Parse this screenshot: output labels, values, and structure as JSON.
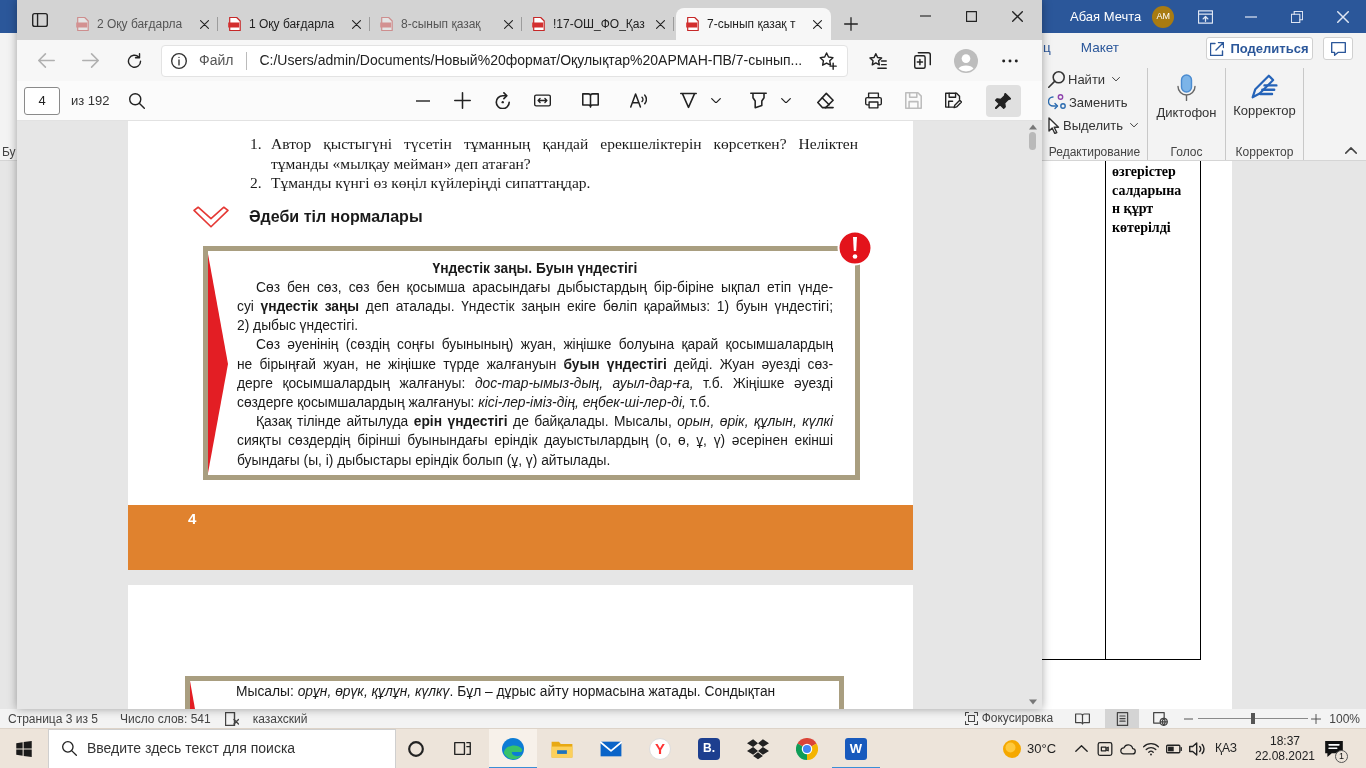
{
  "word_window": {
    "title_bar": {
      "user_name": "Абая Мечта",
      "avatar_initials": "АМ"
    },
    "ribbon_tabs": [
      {
        "label": "ц",
        "selected": false
      },
      {
        "label": "Макет",
        "selected": false
      }
    ],
    "share_button": "Поделиться",
    "ribbon": {
      "cut_group_label": "Бу",
      "groups": [
        {
          "kind": "small",
          "title": "Редактирование",
          "items": [
            {
              "kind": "find",
              "label": "Найти",
              "dropdown": true
            },
            {
              "kind": "replace",
              "label": "Заменить",
              "dropdown": false
            },
            {
              "kind": "select",
              "label": "Выделить",
              "dropdown": true
            }
          ]
        },
        {
          "kind": "large",
          "title": "Голос",
          "items": [
            {
              "kind": "dictate",
              "label": "Диктофон"
            }
          ]
        },
        {
          "kind": "large",
          "title": "Корректор",
          "items": [
            {
              "kind": "editor",
              "label": "Корректор"
            }
          ]
        }
      ]
    },
    "document": {
      "table_cell": "өзгерістер\nсалдарына\nн құрт\nкөтерілді"
    },
    "status_bar": {
      "page": "Страница 3 из 5",
      "word_count": "Число слов: 541",
      "language": "казахский",
      "focus": "Фокусировка",
      "views": [
        {
          "kind": "read",
          "selected": false
        },
        {
          "kind": "print",
          "selected": true
        },
        {
          "kind": "web",
          "selected": false
        }
      ],
      "zoom_slider": {
        "level": 0.5
      },
      "zoom": "100%"
    }
  },
  "browser_window": {
    "tabs": [
      {
        "title": "2 Оқу бағдарла",
        "sleeping": true,
        "selected": false
      },
      {
        "title": "1 Оқу бағдарла",
        "sleeping": false,
        "selected": false
      },
      {
        "title": "8-сынып қазақ",
        "sleeping": true,
        "selected": false
      },
      {
        "title": "!17-ОШ_ФО_Қаз",
        "sleeping": false,
        "selected": false
      },
      {
        "title": "7-сынып қазақ т",
        "sleeping": false,
        "selected": true
      }
    ],
    "nav_buttons": [
      {
        "kind": "back",
        "disabled": true
      },
      {
        "kind": "forward",
        "disabled": true
      },
      {
        "kind": "refresh",
        "disabled": false
      }
    ],
    "address_bar": {
      "scheme": "Файл",
      "url": "C:/Users/admin/Documents/Новый%20формат/Оқулықтар%20АРМАН-ПВ/7-сынып..."
    },
    "pdf_toolbar": {
      "page_number": "4",
      "page_count": "из 192",
      "tools": [
        {
          "kind": "zoom_out",
          "disabled": false,
          "dropdown": false
        },
        {
          "kind": "zoom_in",
          "disabled": false,
          "dropdown": false
        },
        {
          "kind": "rotate",
          "disabled": false,
          "dropdown": false
        },
        {
          "kind": "fit",
          "disabled": false,
          "dropdown": false
        },
        {
          "kind": "page_view",
          "disabled": false,
          "dropdown": false
        },
        {
          "kind": "read_aloud",
          "disabled": false,
          "dropdown": false
        },
        {
          "kind": "draw",
          "disabled": false,
          "dropdown": true
        },
        {
          "kind": "highlight",
          "disabled": false,
          "dropdown": true
        },
        {
          "kind": "erase",
          "disabled": false,
          "dropdown": false
        },
        {
          "kind": "print",
          "disabled": false,
          "dropdown": false
        },
        {
          "kind": "save",
          "disabled": true,
          "dropdown": false
        },
        {
          "kind": "save_as",
          "disabled": false,
          "dropdown": false
        }
      ],
      "pin": {
        "selected": true
      }
    },
    "pdf": {
      "page_1": {
        "questions": [
          {
            "number": "1.",
            "text": "Автор қыстыгүні түсетін тұманның қандай ерекшеліктерін көрсеткен? Неліктен\nтұманды «мылқау мейман» деп атаған?"
          },
          {
            "number": "2.",
            "text": "Тұманды күнгі өз көңіл күйлеріңді сипаттаңдар."
          }
        ],
        "section_heading": "Әдеби тіл нормалары",
        "rule_box": {
          "title": "Үндестік заңы. Буын үндестігі",
          "paragraphs": [
            "Сөз бен сөз, сөз бен қосымша арасындағы дыбыстардың бір-біріне ықпал етіп үнде-\nсуі **үндестік заңы** деп аталады. Үндестік заңын екіге бөліп қараймыз: 1) буын үндестігі;\n2) дыбыс үндестігі.",
            "Сөз әуенінің (сөздің соңғы буынының) жуан, жіңішке болуына қарай қосымшалардың\nне бірыңғай жуан, не жіңішке түрде жалғануын **буын үндестігі** дейді. Жуан әуезді сөз-\nдерге қосымшалардың жалғануы: *дос-тар-ымыз-дың, ауыл-дар-ға,* т.б. Жіңішке әуезді\nсөздерге қосымшалардың жалғануы: *кісі-лер-іміз-дің, еңбек-ші-лер-ді,* т.б.",
            "Қазақ тілінде айтылуда **ерін үндестігі** де байқалады. Мысалы, *орын, өрік, құлын, күлкі*\nсияқты сөздердің бірінші буынындағы еріндік дауыстылардың (о, ө, ұ, ү) әсерінен екінші\nбуындағы (ы, і) дыбыстары еріндік болып (ұ, ү) айтылады."
          ]
        },
        "page_number": "4"
      },
      "page_2": {
        "box_text": "Мысалы: *орұн, өрүк, құлұн, күлкү*. Бұл – дұрыс айту нормасына жатады. Сондықтан"
      }
    }
  },
  "taskbar": {
    "search_placeholder": "Введите здесь текст для поиска",
    "apps": [
      {
        "kind": "edge",
        "running": true,
        "selected": true
      },
      {
        "kind": "explorer",
        "running": false,
        "selected": false
      },
      {
        "kind": "mail",
        "running": false,
        "selected": false
      },
      {
        "kind": "yandex",
        "label": "Y",
        "running": false,
        "selected": false
      },
      {
        "kind": "tile",
        "label": "B.",
        "running": false,
        "selected": false
      },
      {
        "kind": "dropbox",
        "running": false,
        "selected": false
      },
      {
        "kind": "chrome",
        "running": false,
        "selected": false
      },
      {
        "kind": "word",
        "label": "W",
        "running": true,
        "selected": false
      }
    ],
    "weather": "30°C",
    "language": "ҚАЗ",
    "time": "18:37",
    "date": "22.08.2021",
    "notification_count": "1"
  }
}
